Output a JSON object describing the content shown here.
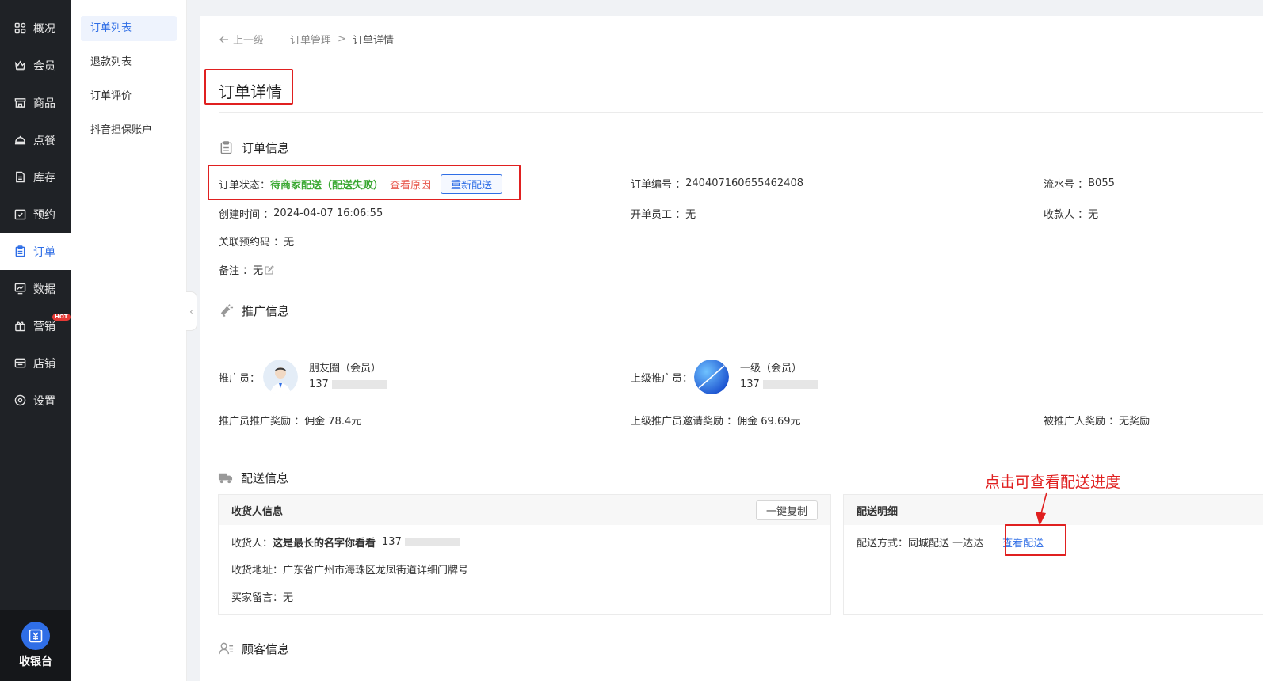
{
  "nav": {
    "items": [
      {
        "label": "概况",
        "icon": "grid-icon"
      },
      {
        "label": "会员",
        "icon": "crown-icon"
      },
      {
        "label": "商品",
        "icon": "store-icon"
      },
      {
        "label": "点餐",
        "icon": "dish-icon"
      },
      {
        "label": "库存",
        "icon": "inventory-icon"
      },
      {
        "label": "预约",
        "icon": "calendar-check-icon"
      },
      {
        "label": "订单",
        "icon": "clipboard-icon",
        "active": true
      },
      {
        "label": "数据",
        "icon": "chart-monitor-icon"
      },
      {
        "label": "营销",
        "icon": "gift-icon",
        "badge": "HOT"
      },
      {
        "label": "店铺",
        "icon": "shop-icon"
      },
      {
        "label": "设置",
        "icon": "gear-icon"
      }
    ],
    "cashier_label": "收银台"
  },
  "subnav": {
    "items": [
      "订单列表",
      "退款列表",
      "订单评价",
      "抖音担保账户"
    ]
  },
  "breadcrumb": {
    "back": "上一级",
    "parent": "订单管理",
    "separator": ">",
    "current": "订单详情"
  },
  "page_title": "订单详情",
  "order_info": {
    "title": "订单信息",
    "status_label": "订单状态：",
    "status_value": "待商家配送（配送失败）",
    "view_reason": "查看原因",
    "redeliver_button": "重新配送",
    "order_no_label": "订单编号 ：",
    "order_no": "240407160655462408",
    "serial_label": "流水号 ：",
    "serial": "B055",
    "created_label": "创建时间 ：",
    "created": "2024-04-07 16:06:55",
    "staff_label": "开单员工 ：",
    "staff": "无",
    "payee_label": "收款人 ：",
    "payee": "无",
    "reservation_label": "关联预约码 ：",
    "reservation": "无",
    "remark_label": "备注 ：",
    "remark": "无"
  },
  "promo_info": {
    "title": "推广信息",
    "promoter_label": "推广员：",
    "promoter_name": "朋友圈（会员）",
    "promoter_phone": "137",
    "upper_label": "上级推广员：",
    "upper_name": "一级（会员）",
    "upper_phone": "137",
    "promoter_reward_label": "推广员推广奖励 ：",
    "promoter_reward": "佣金 78.4元",
    "upper_reward_label": "上级推广员邀请奖励 ：",
    "upper_reward": "佣金 69.69元",
    "invitee_reward_label": "被推广人奖励 ：",
    "invitee_reward": "无奖励"
  },
  "delivery_info": {
    "title": "配送信息",
    "receiver_box_title": "收货人信息",
    "copy_button": "一键复制",
    "receiver_label": "收货人：",
    "receiver_name": "这是最长的名字你看看",
    "receiver_phone": "137",
    "address_label": "收货地址：",
    "address": "广东省广州市海珠区龙凤街道详细门牌号",
    "message_label": "买家留言：",
    "message": "无",
    "detail_box_title": "配送明细",
    "method_label": "配送方式：",
    "method": "同城配送 一达达",
    "view_delivery": "查看配送"
  },
  "annotation": "点击可查看配送进度",
  "customer_info": {
    "title": "顾客信息"
  },
  "colors": {
    "accent": "#2f6ee6",
    "success": "#3aa832",
    "danger": "#e02020",
    "sidebar": "#1f2226"
  }
}
